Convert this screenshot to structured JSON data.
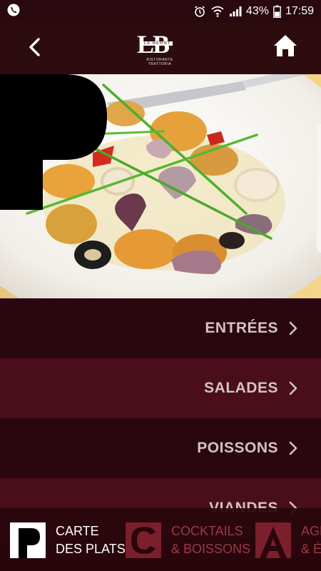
{
  "status_bar": {
    "battery_percent": "43%",
    "time": "17:59"
  },
  "header": {
    "logo": {
      "letters": "LB",
      "name": "LE BERNY",
      "subtitle_line1": "RISTORANTE",
      "subtitle_line2": "TRATTORIA"
    }
  },
  "hero": {
    "section_letter": "P"
  },
  "menu": {
    "items": [
      {
        "label": "ENTRÉES"
      },
      {
        "label": "SALADES"
      },
      {
        "label": "POISSONS"
      },
      {
        "label": "VIANDES"
      }
    ]
  },
  "tabs": [
    {
      "letter": "P",
      "line1": "CARTE",
      "line2": "DES PLATS"
    },
    {
      "letter": "C",
      "line1": "COCKTAILS",
      "line2": "& BOISSONS"
    },
    {
      "letter": "A",
      "line1": "AGENDA",
      "line2": "& ÉVÉNEMENTS"
    }
  ],
  "colors": {
    "header_bg": "#2c0c0f",
    "menu_row_dark": "#2a0710",
    "menu_row_light": "#4a0d1c",
    "menu_text": "#d3c3c3",
    "tab_active_text": "#ffffff",
    "tab_inactive_text": "#9c3a45"
  }
}
